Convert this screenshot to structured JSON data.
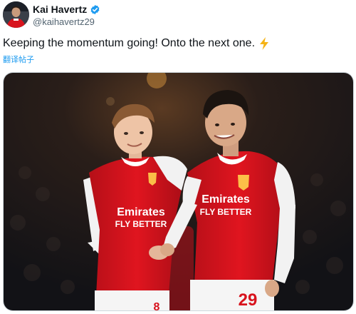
{
  "post": {
    "author": {
      "display_name": "Kai Havertz",
      "handle": "@kaihavertz29",
      "verified": true,
      "avatar_icon": "avatar-photo"
    },
    "text": "Keeping the momentum going! Onto the next one.",
    "emoji_icon": "lightning-bolt-icon",
    "translate_label": "翻译帖子",
    "media": {
      "kind": "photo",
      "left_shirt": {
        "sponsor_1": "Emirates",
        "sponsor_2": "FLY BETTER",
        "number": "8"
      },
      "right_shirt": {
        "sponsor_1": "Emirates",
        "sponsor_2": "FLY BETTER",
        "number": "29"
      }
    }
  },
  "colors": {
    "accent_link": "#1d9bf0",
    "verified_badge": "#1d9bf0",
    "kit_red": "#d8131d",
    "bolt": "#f5b316"
  }
}
